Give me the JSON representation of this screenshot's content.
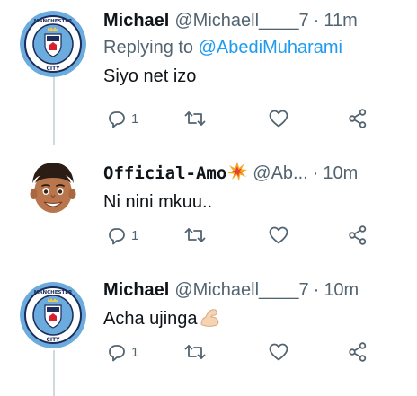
{
  "tweets": [
    {
      "author": "Michael",
      "handle": "@Michaell____7",
      "separator": "·",
      "time": "11m",
      "replying_prefix": "Replying to",
      "replying_to": "@AbediMuharami",
      "text": "Siyo net izo",
      "reply_count": "1",
      "avatar": "manchester-city-badge"
    },
    {
      "author": "Official-Amo",
      "handle": "@Ab...",
      "separator": "·",
      "time": "10m",
      "text": "Ni nini mkuu..",
      "reply_count": "1",
      "avatar": "memoji-avatar"
    },
    {
      "author": "Michael",
      "handle": "@Michaell____7",
      "separator": "·",
      "time": "10m",
      "text": "Acha ujinga",
      "reply_count": "1",
      "avatar": "manchester-city-badge"
    }
  ],
  "icons": {
    "reply": "reply-icon",
    "retweet": "retweet-icon",
    "like": "heart-icon",
    "share": "share-icon"
  },
  "colors": {
    "text": "#0f1419",
    "secondary": "#536471",
    "link": "#1d9bf0",
    "badge_blue": "#6cabdd",
    "thread_line": "#cfd9de"
  }
}
